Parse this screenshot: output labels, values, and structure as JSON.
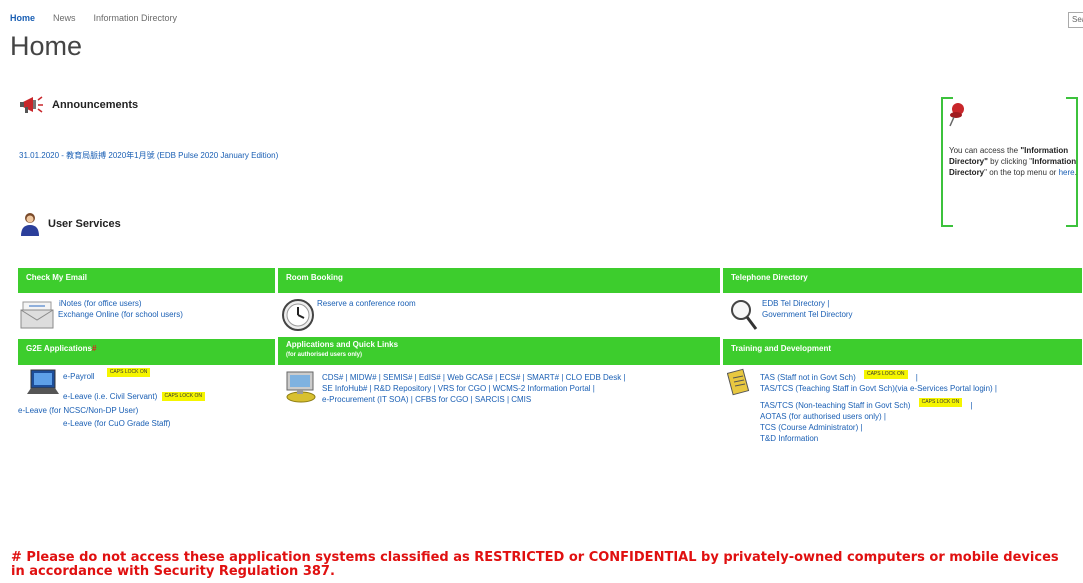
{
  "nav": {
    "items": [
      "Home",
      "News",
      "Information Directory"
    ],
    "search_placeholder": "Sea"
  },
  "page_title": "Home",
  "announcements": {
    "heading": "Announcements",
    "link": "31.01.2020 - 教育局脈搏 2020年1月號 (EDB Pulse 2020 January Edition)"
  },
  "info_box": {
    "line1": "You can access the",
    "bold1": "\"Information Directory\"",
    "line2": " by clicking \"",
    "bold2": "Information Directory",
    "line3": "\" on the top menu or ",
    "here": "here",
    "end": "."
  },
  "user_services": {
    "heading": "User Services"
  },
  "panels": {
    "email": {
      "title": "Check My Email",
      "links": [
        "iNotes (for office users)",
        "Exchange Online (for school users)"
      ]
    },
    "room": {
      "title": "Room Booking",
      "links": [
        "Reserve a conference room"
      ]
    },
    "tel": {
      "title": "Telephone Directory",
      "links": [
        "EDB Tel Directory |",
        "Government Tel Directory"
      ]
    },
    "g2e": {
      "title": "G2E Applications",
      "hash": "#",
      "links": [
        "e-Payroll",
        "e-Leave (i.e. Civil Servant)",
        "e-Leave (for NCSC/Non-DP User)",
        "e-Leave (for CuO Grade Staff)"
      ],
      "tag": "CAPS LOCK ON"
    },
    "apps": {
      "title": "Applications and Quick Links",
      "subtitle": "(for authorised users only)",
      "lines": [
        "CDS# | MIDW# | SEMIS# | EdIS# | Web GCAS# | ECS# | SMART# | CLO EDB Desk |",
        "SE InfoHub# | R&D Repository | VRS for CGO | WCMS-2 Information Portal |",
        "e-Procurement (IT SOA) | CFBS for CGO | SARCIS | CMIS"
      ]
    },
    "training": {
      "title": "Training and Development",
      "links": [
        "TAS (Staff not in Govt Sch)",
        "TAS/TCS (Teaching Staff in Govt Sch)(via e-Services Portal login) |",
        "TAS/TCS (Non-teaching Staff in Govt Sch)",
        "AOTAS (for authorised users only) |",
        "TCS (Course Administrator) |",
        "T&D Information"
      ],
      "tag": "CAPS LOCK ON"
    }
  },
  "footer_warning": "# Please do not access these application systems classified as RESTRICTED or CONFIDENTIAL by privately-owned computers or mobile devices in accordance with Security Regulation 387.",
  "colors": {
    "accent_green": "#3dcd2d",
    "link_blue": "#1a5fb4",
    "warning_red": "#e01010"
  }
}
